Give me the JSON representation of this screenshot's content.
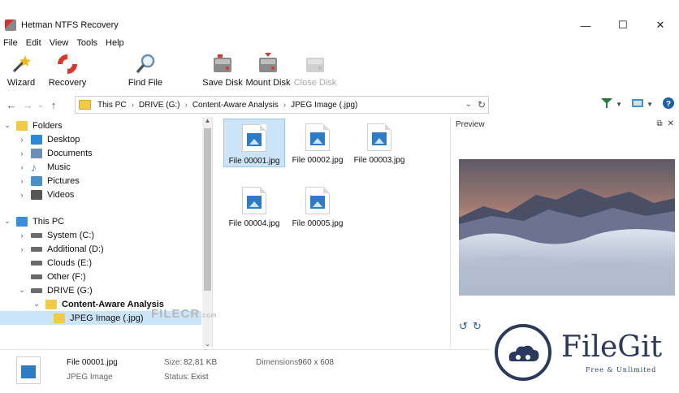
{
  "window": {
    "title": "Hetman NTFS Recovery",
    "min": "—",
    "max": "☐",
    "close": "✕"
  },
  "menu": [
    "File",
    "Edit",
    "View",
    "Tools",
    "Help"
  ],
  "toolbar": [
    {
      "label": "Wizard",
      "icon": "wizard-wand-icon",
      "enabled": true
    },
    {
      "label": "Recovery",
      "icon": "lifebuoy-icon",
      "enabled": true
    },
    {
      "label": "Find File",
      "icon": "magnifier-icon",
      "enabled": true
    },
    {
      "label": "Save Disk",
      "icon": "save-disk-icon",
      "enabled": true
    },
    {
      "label": "Mount Disk",
      "icon": "mount-disk-icon",
      "enabled": true
    },
    {
      "label": "Close Disk",
      "icon": "close-disk-icon",
      "enabled": false
    }
  ],
  "address": {
    "crumbs": [
      "This PC",
      "DRIVE (G:)",
      "Content-Aware Analysis",
      "JPEG Image (.jpg)"
    ],
    "back": "←",
    "forward": "→",
    "down": "⌄",
    "up": "↑",
    "dropdown": "⌄",
    "refresh": "↻"
  },
  "tree": [
    {
      "label": "Folders",
      "chev": "⌄",
      "icon": "folder-icon",
      "color": "#f3c94a",
      "selected": false,
      "bold": false
    },
    {
      "label": "Desktop",
      "chev": "›",
      "icon": "desktop-icon",
      "color": "#2b8ad8",
      "selected": false,
      "bold": false
    },
    {
      "label": "Documents",
      "chev": "›",
      "icon": "documents-icon",
      "color": "#6d8fb5",
      "selected": false,
      "bold": false
    },
    {
      "label": "Music",
      "chev": "›",
      "icon": "music-icon",
      "color": "#2b8ad8",
      "selected": false,
      "bold": false
    },
    {
      "label": "Pictures",
      "chev": "›",
      "icon": "pictures-icon",
      "color": "#4a90c8",
      "selected": false,
      "bold": false
    },
    {
      "label": "Videos",
      "chev": "›",
      "icon": "videos-icon",
      "color": "#555555",
      "selected": false,
      "bold": false
    },
    {
      "label": "This PC",
      "chev": "⌄",
      "icon": "computer-icon",
      "color": "#3b8fd9",
      "selected": false,
      "bold": false
    },
    {
      "label": "System (C:)",
      "chev": "›",
      "icon": "drive-icon",
      "color": "#6a6a6a",
      "selected": false,
      "bold": false
    },
    {
      "label": "Additional (D:)",
      "chev": "›",
      "icon": "drive-icon",
      "color": "#6a6a6a",
      "selected": false,
      "bold": false
    },
    {
      "label": "Clouds (E:)",
      "chev": "",
      "icon": "drive-icon",
      "color": "#6a6a6a",
      "selected": false,
      "bold": false
    },
    {
      "label": "Other (F:)",
      "chev": "",
      "icon": "drive-icon",
      "color": "#6a6a6a",
      "selected": false,
      "bold": false
    },
    {
      "label": "DRIVE (G:)",
      "chev": "⌄",
      "icon": "drive-icon",
      "color": "#6a6a6a",
      "selected": false,
      "bold": false
    },
    {
      "label": "Content-Aware Analysis",
      "chev": "⌄",
      "icon": "search-folder-icon",
      "color": "#f3c94a",
      "selected": false,
      "bold": true
    },
    {
      "label": "JPEG Image (.jpg)",
      "chev": "",
      "icon": "folder-icon",
      "color": "#f3c94a",
      "selected": true,
      "bold": false
    }
  ],
  "files": [
    {
      "name": "File 00001.jpg",
      "selected": true
    },
    {
      "name": "File 00002.jpg",
      "selected": false
    },
    {
      "name": "File 00003.jpg",
      "selected": false
    },
    {
      "name": "File 00004.jpg",
      "selected": false
    },
    {
      "name": "File 00005.jpg",
      "selected": false
    }
  ],
  "preview": {
    "header": "Preview",
    "dock": "⧉",
    "close": "✕",
    "rotate_left": "↺",
    "rotate_right": "↻"
  },
  "status": {
    "file_name": "File 00001.jpg",
    "file_type": "JPEG Image",
    "size_label": "Size:",
    "size_value": "82,81 KB",
    "status_label": "Status:",
    "status_value": "Exist",
    "dimensions_label": "Dimensions:",
    "dimensions_value": "960 x 608"
  },
  "watermarks": {
    "filecr": "FILECR",
    "filecr_suffix": ".com",
    "filegit_name": "FileGit",
    "filegit_tag": "Free & Unlimited"
  },
  "colors": {
    "selection": "#cce4f7",
    "accent": "#2e7bc6",
    "brand_filegit": "#2b3a5c"
  }
}
